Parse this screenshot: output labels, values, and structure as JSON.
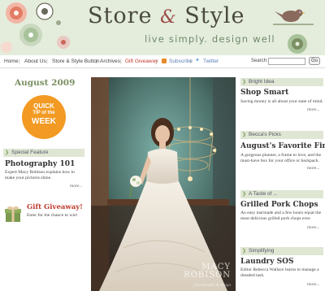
{
  "header": {
    "title_part1": "Store",
    "title_amp": "&",
    "title_part2": "Style",
    "tagline": "live simply. design well"
  },
  "nav": {
    "items": [
      "Home",
      "About Us",
      "Store & Style Button",
      "Archives",
      "Gift Giveaway",
      "Subscribe",
      "Twitter"
    ],
    "search_label": "Search:",
    "search_button": "Go",
    "search_value": ""
  },
  "left": {
    "month": "August 2009",
    "quick_tip_line1": "QUICK",
    "quick_tip_line2": "TIP of the",
    "quick_tip_line3": "WEEK",
    "special_feature_header": "Special Feature",
    "special_feature_title": "Photography 101",
    "special_feature_desc": "Expert Macy Robison explains how to make your pictures shine.",
    "special_feature_more": "more...",
    "gift_title": "Gift Giveaway!",
    "gift_desc": "Enter for the chance to win!"
  },
  "photo": {
    "credit_line1": "MACY",
    "credit_line2": "ROBISON",
    "credit_sub": "photography & design"
  },
  "right": {
    "sections": [
      {
        "header": "Bright Idea",
        "title": "Shop Smart",
        "desc": "Saving money is all about your state of mind.",
        "more": "more..."
      },
      {
        "header": "Becca's Picks",
        "title": "August's Favorite Finds",
        "desc": "A gorgeous planner, a frame to love, and the must-have box for your office or backpack.",
        "more": "more..."
      },
      {
        "header": "A Taste of ...",
        "title": "Grilled Pork Chops",
        "desc": "An easy marinade and a few hours equal the most delicious grilled pork chops ever.",
        "more": "more..."
      },
      {
        "header": "Simplifying",
        "title": "Laundry SOS",
        "desc": "Editor Rebecca Wallace learns to manage a dreaded task.",
        "more": "more..."
      }
    ]
  },
  "colors": {
    "header_bg": "#e4ecdc",
    "section_bar": "#dfe6d3",
    "accent_red": "#c0392b",
    "accent_orange": "#f29a23",
    "link_blue": "#5a7fb5"
  }
}
